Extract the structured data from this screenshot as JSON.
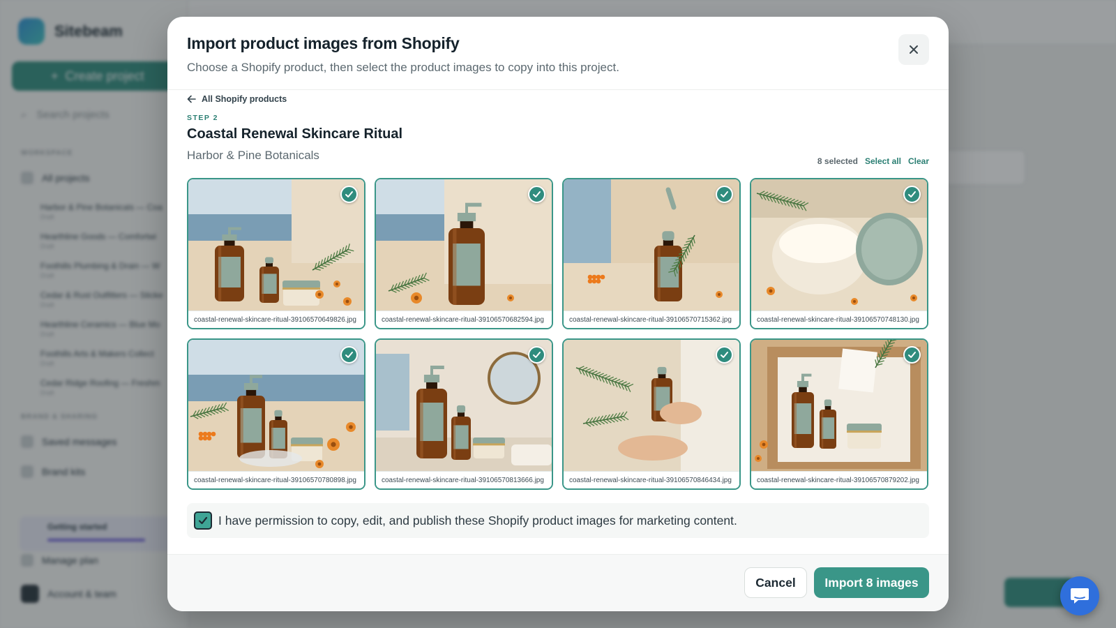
{
  "background": {
    "app_name": "Sitebeam",
    "create_button": "Create project",
    "search_placeholder": "Search projects",
    "section_workspace": "WORKSPACE",
    "all_projects": "All projects",
    "projects": [
      {
        "name": "Harbor & Pine Botanicals — Coa",
        "sub": "Draft"
      },
      {
        "name": "Hearthline Goods — Comfortwi",
        "sub": "Draft"
      },
      {
        "name": "Foothills Plumbing & Drain — W",
        "sub": "Draft"
      },
      {
        "name": "Cedar & Rust Outfitters — Sticke",
        "sub": "Draft"
      },
      {
        "name": "Hearthline Ceramics — Blue Mo",
        "sub": "Draft"
      },
      {
        "name": "Foothills Arts & Makers Collect",
        "sub": "Draft"
      },
      {
        "name": "Cedar Ridge Roofing — Freshm",
        "sub": "Draft"
      }
    ],
    "section_brand": "BRAND & SHARING",
    "brand_items": [
      "Saved messages",
      "Brand kits"
    ],
    "getting_started": "Getting started",
    "manage_plan": "Manage plan",
    "account": "Account & team"
  },
  "modal": {
    "title": "Import product images from Shopify",
    "subtitle": "Choose a Shopify product, then select the product images to copy into this project.",
    "back_link": "All Shopify products",
    "step_label": "STEP 2",
    "product_title": "Coastal Renewal Skincare Ritual",
    "product_vendor": "Harbor & Pine Botanicals",
    "selected_count": "8 selected",
    "select_all": "Select all",
    "clear": "Clear",
    "images": [
      {
        "filename": "coastal-renewal-skincare-ritual-39106570649826.jpg",
        "scene": "trio-sea"
      },
      {
        "filename": "coastal-renewal-skincare-ritual-39106570682594.jpg",
        "scene": "pump-sea"
      },
      {
        "filename": "coastal-renewal-skincare-ritual-39106570715362.jpg",
        "scene": "dropper-sea"
      },
      {
        "filename": "coastal-renewal-skincare-ritual-39106570748130.jpg",
        "scene": "jar-open"
      },
      {
        "filename": "coastal-renewal-skincare-ritual-39106570780898.jpg",
        "scene": "trio-petri"
      },
      {
        "filename": "coastal-renewal-skincare-ritual-39106570813666.jpg",
        "scene": "bathroom"
      },
      {
        "filename": "coastal-renewal-skincare-ritual-39106570846434.jpg",
        "scene": "hands"
      },
      {
        "filename": "coastal-renewal-skincare-ritual-39106570879202.jpg",
        "scene": "giftbox"
      }
    ],
    "permission_text": "I have permission to copy, edit, and publish these Shopify product images for marketing content.",
    "permission_checked": true,
    "cancel_label": "Cancel",
    "import_label": "Import 8 images"
  },
  "colors": {
    "accent": "#3a9688",
    "accent_dark": "#2f8c7e",
    "bottle_label": "#8fa89c",
    "amber": "#7a3e12",
    "chat_fab": "#2f6fdc"
  }
}
